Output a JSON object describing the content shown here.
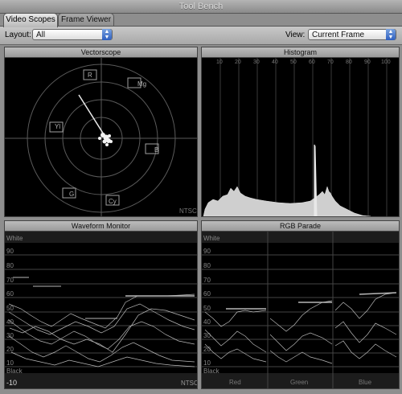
{
  "window": {
    "title": "Tool Bench"
  },
  "tabs": [
    {
      "label": "Video Scopes",
      "active": true
    },
    {
      "label": "Frame Viewer",
      "active": false
    }
  ],
  "toolbar": {
    "layout_label": "Layout:",
    "layout_value": "All",
    "view_label": "View:",
    "view_value": "Current Frame"
  },
  "vectorscope": {
    "title": "Vectorscope",
    "standard": "NTSC",
    "targets": [
      "R",
      "Mg",
      "B",
      "Cy",
      "G",
      "Yl"
    ]
  },
  "histogram": {
    "title": "Histogram",
    "scale": [
      "10",
      "20",
      "30",
      "40",
      "50",
      "60",
      "70",
      "80",
      "90",
      "100"
    ]
  },
  "waveform": {
    "title": "Waveform Monitor",
    "top_label": "White",
    "bottom_label": "Black",
    "levels": [
      "90",
      "80",
      "70",
      "60",
      "50",
      "40",
      "30",
      "20",
      "10"
    ],
    "minus": "-10",
    "standard": "NTSC"
  },
  "rgb_parade": {
    "title": "RGB Parade",
    "top_label": "White",
    "bottom_label": "Black",
    "levels": [
      "90",
      "80",
      "70",
      "60",
      "50",
      "40",
      "30",
      "20",
      "10"
    ],
    "channels": [
      "Red",
      "Green",
      "Blue"
    ]
  },
  "colors": {
    "scope_bg": "#000000",
    "trace": "#e0e0e0",
    "graticule": "#5a5a5a"
  }
}
